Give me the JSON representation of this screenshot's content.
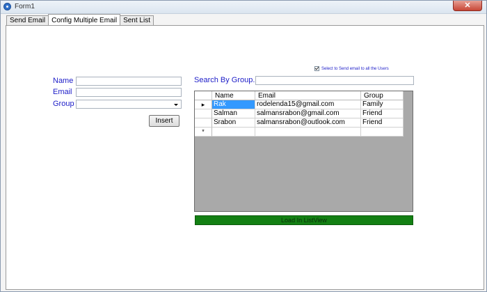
{
  "window": {
    "title": "Form1",
    "close_glyph": "✕"
  },
  "tabs": [
    {
      "label": "Send Email",
      "active": false
    },
    {
      "label": "Config Multiple Email",
      "active": true
    },
    {
      "label": "Sent List",
      "active": false
    }
  ],
  "form": {
    "name_label": "Name",
    "email_label": "Email",
    "group_label": "Group",
    "name_value": "",
    "email_value": "",
    "group_value": "",
    "insert_label": "Insert"
  },
  "search": {
    "label": "Search By Group.",
    "value": ""
  },
  "checkbox": {
    "label": "Select to Send email to all the Users",
    "checked": true
  },
  "grid": {
    "columns": [
      "Name",
      "Email",
      "Group"
    ],
    "rows": [
      {
        "indicator": "▸",
        "name": "Rak",
        "email": "rodelenda15@gmail.com",
        "group": "Family"
      },
      {
        "indicator": "",
        "name": "Salman",
        "email": "salmansrabon@gmail.com",
        "group": "Friend"
      },
      {
        "indicator": "",
        "name": "Srabon",
        "email": "salmansrabon@outlook.com",
        "group": "Friend"
      }
    ],
    "new_row_indicator": "*"
  },
  "load_button": {
    "label": "Load In ListView"
  },
  "colors": {
    "label_blue": "#1c1cc8",
    "selection": "#3399ff",
    "load_green": "#138013",
    "grid_bg": "#a9a9a9"
  }
}
